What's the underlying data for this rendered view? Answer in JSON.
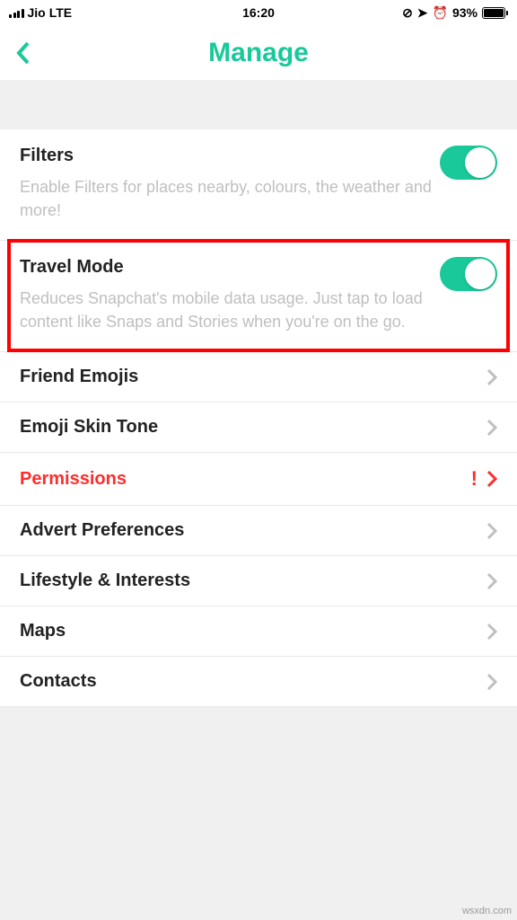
{
  "status": {
    "carrier": "Jio",
    "network": "LTE",
    "time": "16:20",
    "battery_pct": "93%"
  },
  "nav": {
    "title": "Manage"
  },
  "rows": {
    "filters": {
      "title": "Filters",
      "desc": "Enable Filters for places nearby, colours, the weather and more!"
    },
    "travel": {
      "title": "Travel Mode",
      "desc": "Reduces Snapchat's mobile data usage. Just tap to load content like Snaps and Stories when you're on the go."
    },
    "friend_emojis": {
      "title": "Friend Emojis"
    },
    "skin_tone": {
      "title": "Emoji Skin Tone"
    },
    "permissions": {
      "title": "Permissions"
    },
    "adverts": {
      "title": "Advert Preferences"
    },
    "lifestyle": {
      "title": "Lifestyle & Interests"
    },
    "maps": {
      "title": "Maps"
    },
    "contacts": {
      "title": "Contacts"
    }
  },
  "watermark": "wsxdn.com"
}
